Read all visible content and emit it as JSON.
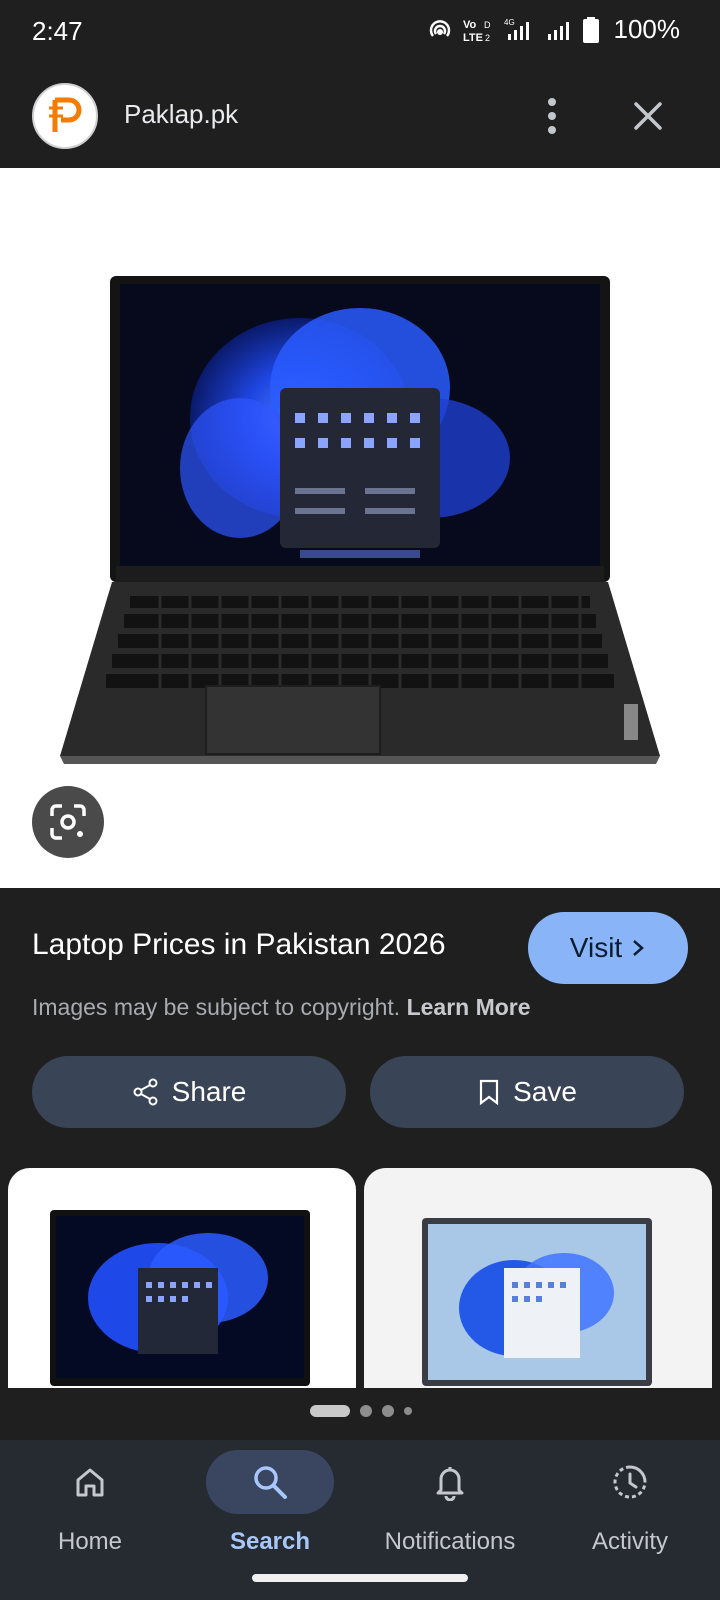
{
  "status_bar": {
    "time": "2:47",
    "network_label": "VoLTE",
    "network_type": "4G",
    "battery": "100%",
    "icons": [
      "hotspot-icon",
      "volte-icon",
      "signal-icon",
      "signal-icon",
      "battery-icon"
    ]
  },
  "header": {
    "site_name": "Paklap.pk",
    "logo_icon": "paklap-logo",
    "actions": [
      "more-vert-icon",
      "close-icon"
    ]
  },
  "image": {
    "subject": "laptop",
    "lens_icon": "google-lens-icon"
  },
  "result": {
    "title": "Laptop Prices in Pakistan 2026",
    "visit_label": "Visit",
    "copyright_text": "Images may be subject to copyright.",
    "learn_more": "Learn More"
  },
  "actions": {
    "share_label": "Share",
    "save_label": "Save"
  },
  "related": {
    "cards": 2
  },
  "pager": {
    "active_index": 0,
    "dots": 4
  },
  "bottom_nav": {
    "items": [
      {
        "label": "Home",
        "icon": "home-icon"
      },
      {
        "label": "Search",
        "icon": "search-icon",
        "active": true
      },
      {
        "label": "Notifications",
        "icon": "bell-icon"
      },
      {
        "label": "Activity",
        "icon": "activity-icon"
      }
    ]
  },
  "colors": {
    "background": "#1f1f1f",
    "accent": "#8ab4f8",
    "action_button": "#394457",
    "nav_background": "#262a31",
    "nav_active": "#a8c7fa"
  }
}
